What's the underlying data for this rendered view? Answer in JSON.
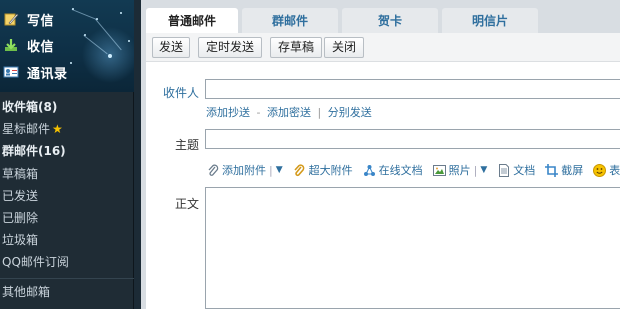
{
  "sidebar": {
    "top": [
      {
        "label": "写信",
        "icon": "compose-icon"
      },
      {
        "label": "收信",
        "icon": "inbox-download-icon"
      },
      {
        "label": "通讯录",
        "icon": "contacts-icon"
      }
    ],
    "folders": [
      {
        "label": "收件箱(8)",
        "bold": true
      },
      {
        "label": "星标邮件",
        "bold": false,
        "star": "★"
      },
      {
        "label": "群邮件(16)",
        "bold": true
      },
      {
        "label": "草稿箱",
        "bold": false
      },
      {
        "label": "已发送",
        "bold": false
      },
      {
        "label": "已删除",
        "bold": false
      },
      {
        "label": "垃圾箱",
        "bold": false
      },
      {
        "label": "QQ邮件订阅",
        "bold": false
      }
    ],
    "other": "其他邮箱"
  },
  "tabs": [
    "普通邮件",
    "群邮件",
    "贺卡",
    "明信片"
  ],
  "toolbar": {
    "send": "发送",
    "scheduled_send": "定时发送",
    "save_draft": "存草稿",
    "close": "关闭"
  },
  "compose": {
    "to_label": "收件人",
    "links": {
      "add_cc": "添加抄送",
      "dash": "-",
      "add_bcc": "添加密送",
      "pipe": "|",
      "separate_send": "分别发送"
    },
    "subject_label": "主题",
    "body_label": "正文",
    "attach": {
      "add_attachment": "添加附件",
      "large_attachment": "超大附件",
      "online_doc": "在线文档",
      "photo": "照片",
      "document": "文档",
      "screenshot": "截屏",
      "emoji_partial": "表"
    }
  },
  "colors": {
    "link": "#2f6f9e",
    "sidebar_bg": "#1f2c35",
    "star": "#f7c300"
  }
}
